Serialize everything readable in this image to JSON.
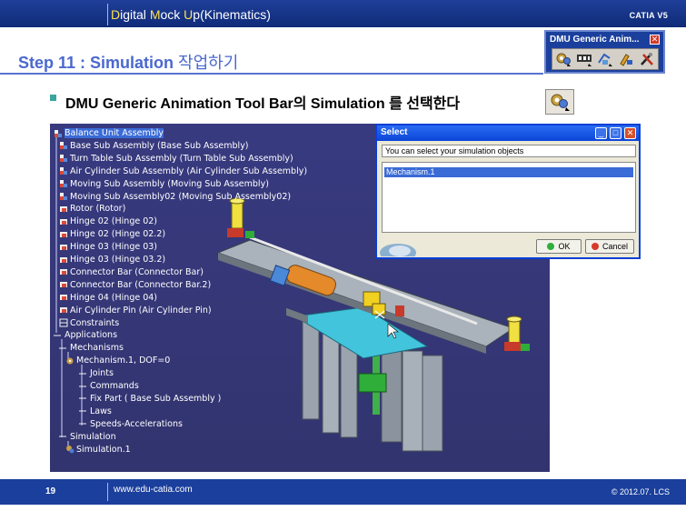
{
  "header": {
    "title_prefix_1": "D",
    "title_part_1": "igital ",
    "title_prefix_2": "M",
    "title_part_2": "ock ",
    "title_prefix_3": "U",
    "title_part_3": "p(Kinematics)",
    "right_label": "CATIA V5"
  },
  "step": {
    "title": "Step 11 : Simulation ",
    "title_korean": "작업하기"
  },
  "toolbar": {
    "title": "DMU Generic Anim...",
    "close_glyph": "✕",
    "icons": [
      "simulation-icon",
      "player-icon",
      "simulation-trace-icon",
      "edit-sequence-icon",
      "tools-icon"
    ]
  },
  "bullet": {
    "text": "DMU Generic Animation Tool Bar의 Simulation 를 선택한다",
    "icon": "simulation-icon"
  },
  "tree": [
    {
      "label": "Balance Unit Assembly",
      "depth": 0,
      "icon": "assembly-icon",
      "selected": true
    },
    {
      "label": "Base Sub Assembly (Base Sub Assembly)",
      "depth": 1,
      "icon": "assembly-icon"
    },
    {
      "label": "Turn Table Sub Assembly (Turn Table Sub Assembly)",
      "depth": 1,
      "icon": "assembly-icon"
    },
    {
      "label": "Air Cylinder Sub Assembly (Air Cylinder Sub Assembly)",
      "depth": 1,
      "icon": "assembly-icon"
    },
    {
      "label": "Moving Sub Assembly (Moving Sub Assembly)",
      "depth": 1,
      "icon": "assembly-icon"
    },
    {
      "label": "Moving Sub Assembly02 (Moving Sub Assembly02)",
      "depth": 1,
      "icon": "assembly-icon"
    },
    {
      "label": "Rotor (Rotor)",
      "depth": 1,
      "icon": "part-icon"
    },
    {
      "label": "Hinge 02 (Hinge 02)",
      "depth": 1,
      "icon": "part-icon"
    },
    {
      "label": "Hinge 02 (Hinge 02.2)",
      "depth": 1,
      "icon": "part-icon"
    },
    {
      "label": "Hinge 03 (Hinge 03)",
      "depth": 1,
      "icon": "part-icon"
    },
    {
      "label": "Hinge 03 (Hinge 03.2)",
      "depth": 1,
      "icon": "part-icon"
    },
    {
      "label": "Connector Bar (Connector Bar)",
      "depth": 1,
      "icon": "part-icon"
    },
    {
      "label": "Connector Bar (Connector Bar.2)",
      "depth": 1,
      "icon": "part-icon"
    },
    {
      "label": "Hinge 04 (Hinge 04)",
      "depth": 1,
      "icon": "part-icon"
    },
    {
      "label": "Air Cylinder Pin (Air Cylinder Pin)",
      "depth": 1,
      "icon": "part-icon"
    },
    {
      "label": "Constraints",
      "depth": 1,
      "icon": "constraints-icon"
    },
    {
      "label": "Applications",
      "depth": 0,
      "icon": "branch-icon"
    },
    {
      "label": "Mechanisms",
      "depth": 1,
      "icon": "branch-icon"
    },
    {
      "label": "Mechanism.1, DOF=0",
      "depth": 2,
      "icon": "mechanism-icon"
    },
    {
      "label": "Joints",
      "depth": 3,
      "icon": "branch-icon"
    },
    {
      "label": "Commands",
      "depth": 3,
      "icon": "branch-icon"
    },
    {
      "label": "Fix Part ( Base Sub Assembly )",
      "depth": 3,
      "icon": "branch-icon"
    },
    {
      "label": "Laws",
      "depth": 3,
      "icon": "branch-icon"
    },
    {
      "label": "Speeds-Accelerations",
      "depth": 3,
      "icon": "branch-icon"
    },
    {
      "label": "Simulation",
      "depth": 1,
      "icon": "branch-icon"
    },
    {
      "label": "Simulation.1",
      "depth": 2,
      "icon": "simulation-icon"
    }
  ],
  "dialog": {
    "title": "Select",
    "message": "You can select your simulation objects",
    "list_items": [
      "Mechanism.1"
    ],
    "ok_label": "OK",
    "cancel_label": "Cancel",
    "minimize_glyph": "_",
    "maximize_glyph": "□",
    "close_glyph": "✕"
  },
  "footer": {
    "page": "19",
    "url": "www.edu-catia.com",
    "copyright": "© 2012.07. LCS"
  },
  "colors": {
    "header_blue": "#1b3f9c",
    "title_blue": "#4a68cf",
    "bullet_teal": "#3aa59d",
    "viewport_bg": "#36387a",
    "selection_blue": "#3a6bd6"
  }
}
